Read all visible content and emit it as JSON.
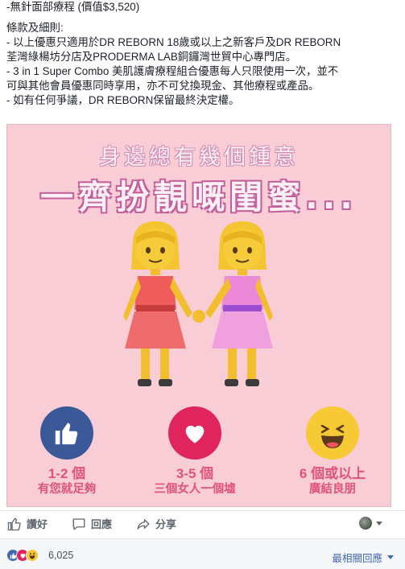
{
  "post": {
    "lines": [
      "-無針面部療程 (價值$3,520)",
      "條款及細則:",
      "- 以上優惠只適用於DR REBORN 18歲或以上之新客戶及DR REBORN",
      "荃灣綠楊坊分店及PRODERMA LAB銅鑼灣世貿中心專門店。",
      "- 3 in 1 Super Combo 美肌護膚療程組合優惠每人只限使用一次，並不",
      "可與其他會員優惠同時享用，亦不可兌換現金、其他療程或產品。",
      "- 如有任何爭議，DR REBORN保留最終決定權。"
    ]
  },
  "image": {
    "headline_small": "身邊總有幾個鍾意",
    "headline_big": "一齊扮靚嘅閨蜜...",
    "reactions": [
      {
        "icon": "like-icon",
        "line1": "1-2 個",
        "line2": "有您就足夠",
        "color": "#3b5998"
      },
      {
        "icon": "love-icon",
        "line1": "3-5 個",
        "line2": "三個女人一個墟",
        "color": "#e0245e"
      },
      {
        "icon": "haha-icon",
        "line1": "6 個或以上",
        "line2": "廣結良朋",
        "color": "#f7c935"
      }
    ]
  },
  "actions": {
    "like": "讚好",
    "comment": "回應",
    "share": "分享"
  },
  "reactions_bar": {
    "count": "6,025",
    "sort_label": "最相關回應"
  },
  "colors": {
    "fb_blue": "#4267b2",
    "pink_bg": "#f8cdd6",
    "label_pink": "#e0537a"
  }
}
